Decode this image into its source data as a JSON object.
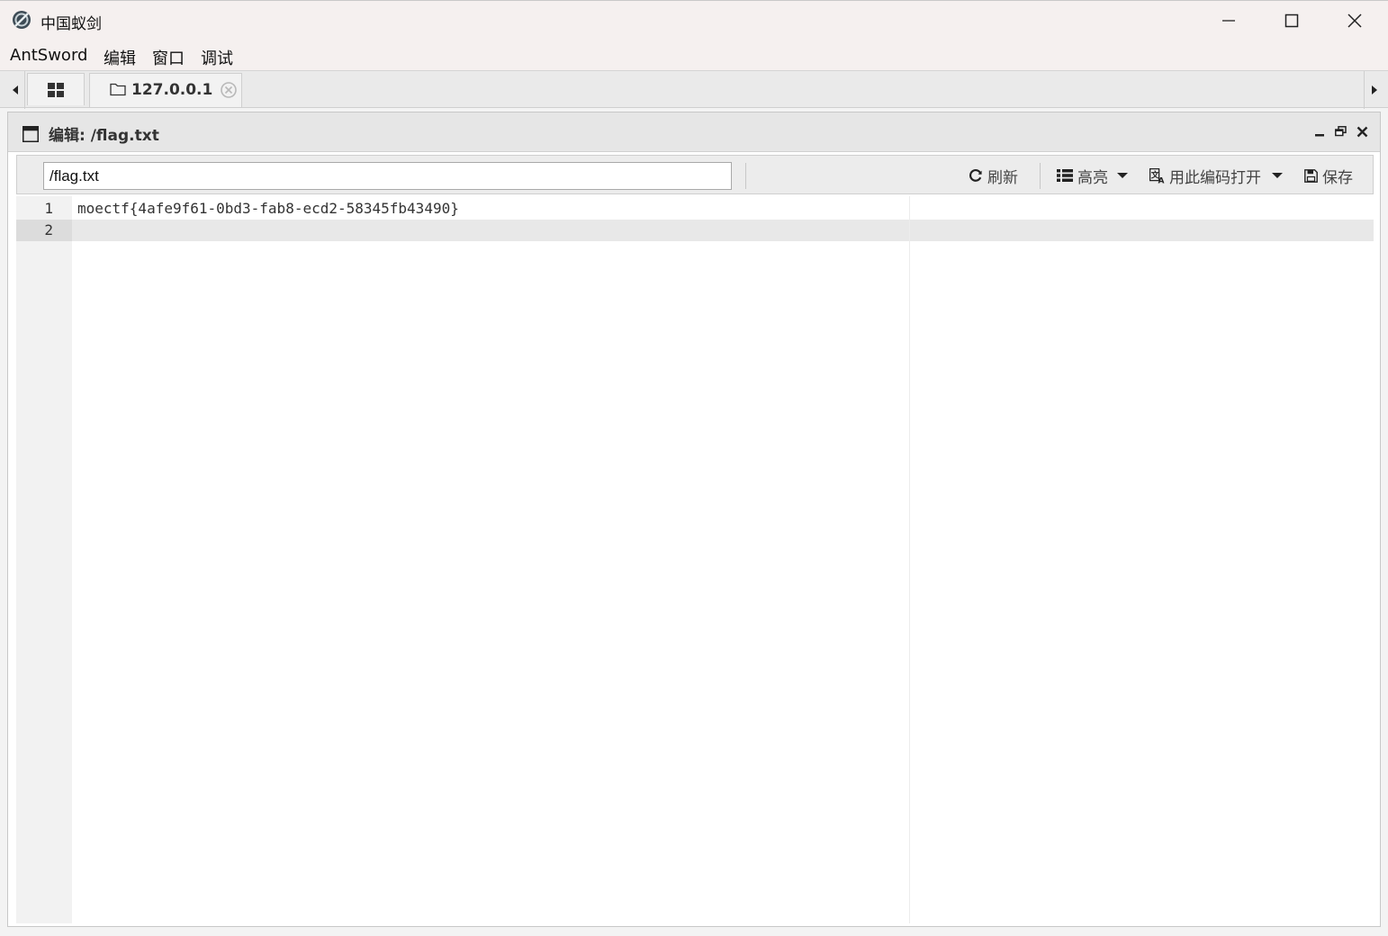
{
  "window": {
    "title": "中国蚁剑",
    "controls": [
      "minimize-icon",
      "maximize-icon",
      "close-icon"
    ]
  },
  "menu": {
    "items": [
      "AntSword",
      "编辑",
      "窗口",
      "调试"
    ]
  },
  "tabs": {
    "home_icon": "grid-icon",
    "session_label": "127.0.0.1"
  },
  "panel": {
    "title": "编辑: /flag.txt",
    "path_value": "/flag.txt",
    "buttons": {
      "refresh": "刷新",
      "highlight": "高亮",
      "open_with_encoding": "用此编码打开",
      "save": "保存"
    }
  },
  "editor": {
    "line_numbers": [
      "1",
      "2"
    ],
    "lines": [
      "moectf{4afe9f61-0bd3-fab8-ecd2-58345fb43490}",
      ""
    ],
    "active_line": 2
  }
}
